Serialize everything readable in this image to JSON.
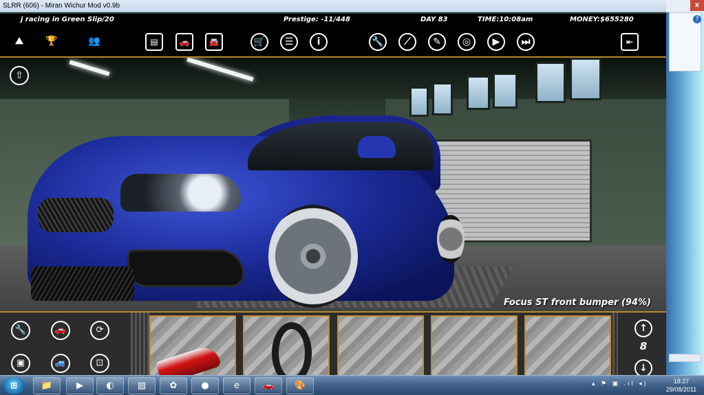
{
  "window": {
    "title": "SLRR (606) - Miran Wichur Mod v0.9b",
    "close": "x"
  },
  "hud": {
    "race_info": "j racing in Green Slip/20",
    "prestige": "Prestige: -11/448",
    "day": "DAY 83",
    "time": "TIME:10:08am",
    "money": "MONEY:$655280"
  },
  "toolbar": [
    {
      "name": "road-icon",
      "glyph": "⛰",
      "shape": "plain"
    },
    {
      "name": "trophy-icon",
      "glyph": "🏆",
      "shape": "plain"
    },
    {
      "name": "people-icon",
      "glyph": "👥",
      "shape": "plain"
    },
    {
      "name": "car-list-icon",
      "glyph": "▤",
      "shape": "square"
    },
    {
      "name": "car-icon",
      "glyph": "🚗",
      "shape": "square"
    },
    {
      "name": "car-garage-icon",
      "glyph": "🚘",
      "shape": "square"
    },
    {
      "name": "shop-cart-icon",
      "glyph": "🛒",
      "shape": "circle"
    },
    {
      "name": "list-icon",
      "glyph": "☰",
      "shape": "circle"
    },
    {
      "name": "info-icon",
      "glyph": "i",
      "shape": "circle"
    },
    {
      "name": "wrench-icon",
      "glyph": "🔧",
      "shape": "circle"
    },
    {
      "name": "screwdriver-icon",
      "glyph": "⟋",
      "shape": "circle"
    },
    {
      "name": "spray-icon",
      "glyph": "✎",
      "shape": "circle"
    },
    {
      "name": "steering-wheel-icon",
      "glyph": "◎",
      "shape": "circle"
    },
    {
      "name": "play-icon",
      "glyph": "▶",
      "shape": "circle"
    },
    {
      "name": "fast-forward-icon",
      "glyph": "⏭",
      "shape": "circle"
    },
    {
      "name": "exit-icon",
      "glyph": "⇤",
      "shape": "square"
    }
  ],
  "corner_button": {
    "name": "car-lift-icon",
    "glyph": "⇧"
  },
  "selected_part": "Focus ST front bumper (94%)",
  "tool_buttons": [
    {
      "name": "wrench-tool-icon",
      "glyph": "🔧"
    },
    {
      "name": "paint-tool-icon",
      "glyph": "🚗"
    },
    {
      "name": "rotate-tool-icon",
      "glyph": "⟳"
    },
    {
      "name": "rack-tool-icon",
      "glyph": "▣"
    },
    {
      "name": "car-tool-icon",
      "glyph": "🚙"
    },
    {
      "name": "frame-tool-icon",
      "glyph": "⊡"
    }
  ],
  "parts_slots": [
    {
      "name": "slot-taillight"
    },
    {
      "name": "slot-steering-wheel"
    },
    {
      "name": "slot-empty-1"
    },
    {
      "name": "slot-empty-2"
    },
    {
      "name": "slot-empty-3"
    }
  ],
  "pager": {
    "up": "↑",
    "page": "8",
    "down": "↓"
  },
  "taskbar": {
    "start": "⊞",
    "items": [
      "📁",
      "▶",
      "◐",
      "▨",
      "✿",
      "●",
      "e",
      "🚗",
      "🎨"
    ],
    "tray": "▴ ⚑ ▣ .ıl ◂)",
    "time": "18:27",
    "date": "29/08/2011"
  },
  "colors": {
    "accent": "#b8892c",
    "car": "#1c2c9c",
    "hud_bg": "#000000"
  }
}
